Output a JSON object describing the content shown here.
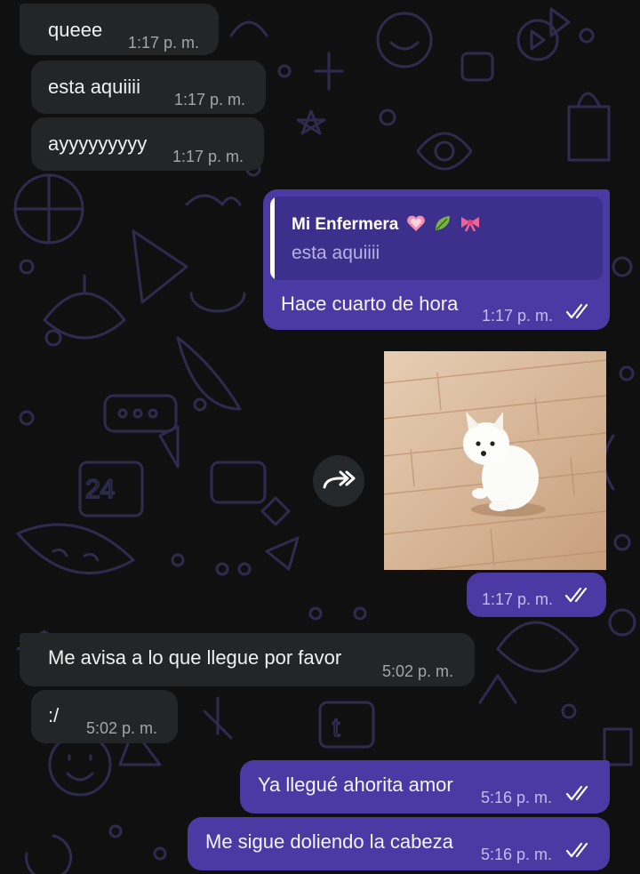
{
  "messages": [
    {
      "text": "queee",
      "time": "1:17 p. m."
    },
    {
      "text": "esta aquiiii",
      "time": "1:17 p. m."
    },
    {
      "text": "ayyyyyyyyy",
      "time": "1:17 p. m."
    },
    {
      "reply_author": "Mi Enfermera",
      "reply_text": "esta aquiiii",
      "text": "Hace cuarto de hora",
      "time": "1:17 p. m."
    },
    {
      "time": "1:17 p. m."
    },
    {
      "text": "Me avisa a lo que llegue por favor",
      "time": "5:02 p. m."
    },
    {
      "text": ":/",
      "time": "5:02 p. m."
    },
    {
      "text": "Ya llegué ahorita amor",
      "time": "5:16 p. m."
    },
    {
      "text": "Me sigue doliendo la cabeza",
      "time": "5:16 p. m."
    }
  ],
  "icons": {
    "read_receipt": "double-check-icon",
    "forward": "forward-arrow-icon",
    "reply_emojis": [
      "pink-heart",
      "leaf",
      "pink-ribbon"
    ]
  },
  "colors": {
    "background": "#101011",
    "incoming_bubble": "#232526",
    "outgoing_bubble": "#4b3aa3",
    "quote_background": "#3d2f8c",
    "pattern": "#3a3560"
  }
}
